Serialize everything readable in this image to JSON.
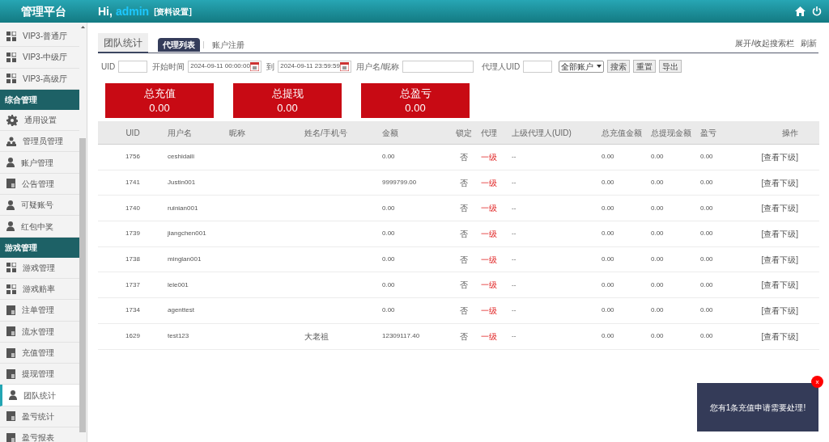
{
  "header": {
    "brand": "管理平台",
    "greeting": "Hi,",
    "user": "admin",
    "profile_link": "[资料设置]"
  },
  "sidebar": [
    {
      "kind": "grid",
      "label": "VIP3-普通厅",
      "selected": false
    },
    {
      "kind": "grid",
      "label": "VIP3-中级厅",
      "selected": false
    },
    {
      "kind": "grid",
      "label": "VIP3-高级厅",
      "selected": false
    },
    {
      "kind": "section",
      "label": "综合管理"
    },
    {
      "kind": "gear",
      "label": "通用设置",
      "selected": false
    },
    {
      "kind": "users",
      "label": "管理员管理",
      "selected": false
    },
    {
      "kind": "user",
      "label": "账户管理",
      "selected": false
    },
    {
      "kind": "doc",
      "label": "公告管理",
      "selected": false
    },
    {
      "kind": "user",
      "label": "可疑账号",
      "selected": false
    },
    {
      "kind": "user",
      "label": "红包中奖",
      "selected": false
    },
    {
      "kind": "section",
      "label": "游戏管理"
    },
    {
      "kind": "grid",
      "label": "游戏管理",
      "selected": false
    },
    {
      "kind": "grid",
      "label": "游戏赔率",
      "selected": false
    },
    {
      "kind": "doc",
      "label": "注单管理",
      "selected": false
    },
    {
      "kind": "doc",
      "label": "流水管理",
      "selected": false
    },
    {
      "kind": "doc",
      "label": "充值管理",
      "selected": false
    },
    {
      "kind": "doc",
      "label": "提现管理",
      "selected": false
    },
    {
      "kind": "user",
      "label": "团队统计",
      "selected": true
    },
    {
      "kind": "doc",
      "label": "盈亏统计",
      "selected": false
    },
    {
      "kind": "doc",
      "label": "盈亏报表",
      "selected": false
    }
  ],
  "page_title": "团队统计",
  "tabs": [
    {
      "label": "代理列表",
      "selected": true
    },
    {
      "label": "账户注册",
      "selected": false
    }
  ],
  "top_links": [
    "展开/收起搜索栏",
    "刷新"
  ],
  "filters": {
    "uid_label": "UID",
    "start_label": "开始时间",
    "start_value": "2024-09-11 00:00:00",
    "to_label": "到",
    "end_value": "2024-09-11 23:59:59",
    "name_label": "用户名/昵称",
    "agent_label": "代理人UID",
    "account_select": "全部账户",
    "buttons": [
      "搜索",
      "重置",
      "导出"
    ]
  },
  "stats": [
    {
      "label": "总充值",
      "value": "0.00"
    },
    {
      "label": "总提现",
      "value": "0.00"
    },
    {
      "label": "总盈亏",
      "value": "0.00"
    }
  ],
  "table": {
    "columns": [
      "UID",
      "用户名",
      "昵称",
      "姓名/手机号",
      "金额",
      "锁定",
      "代理",
      "上级代理人(UID)",
      "总充值金额",
      "总提现金额",
      "盈亏",
      "操作"
    ],
    "rows": [
      [
        "1756",
        "ceshidaili",
        "",
        "",
        "0.00",
        "否",
        "一级",
        "--",
        "0.00",
        "0.00",
        "0.00",
        "[查看下级]"
      ],
      [
        "1741",
        "Justin001",
        "",
        "",
        "9999799.00",
        "否",
        "一级",
        "--",
        "0.00",
        "0.00",
        "0.00",
        "[查看下级]"
      ],
      [
        "1740",
        "ruinian001",
        "",
        "",
        "0.00",
        "否",
        "一级",
        "--",
        "0.00",
        "0.00",
        "0.00",
        "[查看下级]"
      ],
      [
        "1739",
        "jiangchen001",
        "",
        "",
        "0.00",
        "否",
        "一级",
        "--",
        "0.00",
        "0.00",
        "0.00",
        "[查看下级]"
      ],
      [
        "1738",
        "minglan001",
        "",
        "",
        "0.00",
        "否",
        "一级",
        "--",
        "0.00",
        "0.00",
        "0.00",
        "[查看下级]"
      ],
      [
        "1737",
        "lele001",
        "",
        "",
        "0.00",
        "否",
        "一级",
        "--",
        "0.00",
        "0.00",
        "0.00",
        "[查看下级]"
      ],
      [
        "1734",
        "agenttest",
        "",
        "",
        "0.00",
        "否",
        "一级",
        "--",
        "0.00",
        "0.00",
        "0.00",
        "[查看下级]"
      ],
      [
        "1629",
        "test123",
        "",
        "大老祖",
        "12309117.40",
        "否",
        "一级",
        "--",
        "0.00",
        "0.00",
        "0.00",
        "[查看下级]"
      ]
    ]
  },
  "toast": {
    "message": "您有1条充值申请需要处理!",
    "close": "x"
  }
}
